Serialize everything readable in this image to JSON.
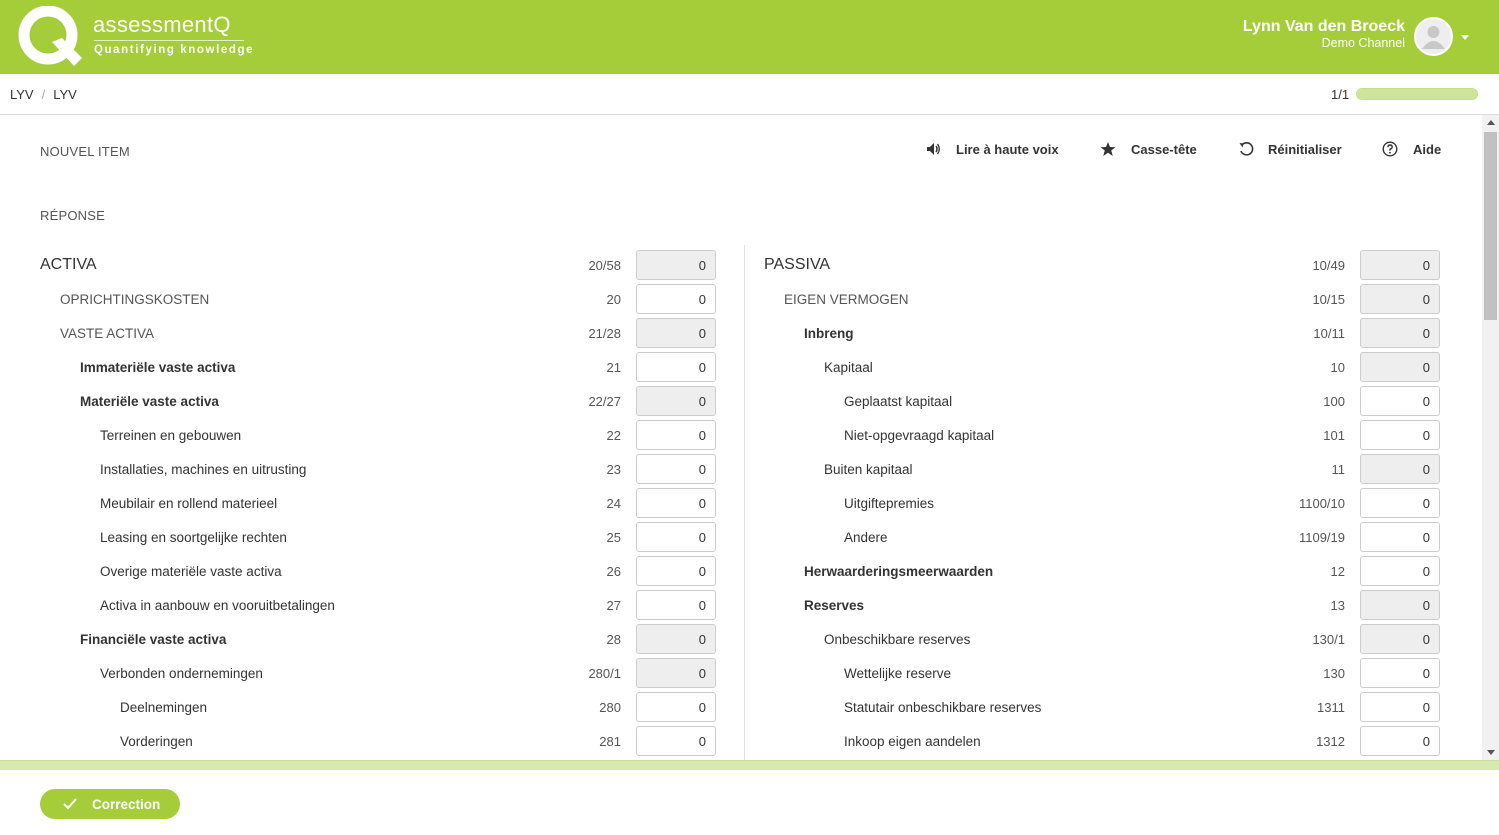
{
  "brand": {
    "name": "assessmentQ",
    "tagline": "Quantifying knowledge",
    "color": "#a5cd39"
  },
  "user": {
    "name": "Lynn Van den Broeck",
    "channel": "Demo Channel"
  },
  "breadcrumb": [
    "LYV",
    "LYV"
  ],
  "progress": {
    "label": "1/1",
    "fraction": 1.0
  },
  "item": {
    "title": "NOUVEL ITEM",
    "response_label": "RÉPONSE"
  },
  "toolbar": {
    "read_aloud": "Lire à haute voix",
    "puzzle": "Casse-tête",
    "reset": "Réinitialiser",
    "help": "Aide"
  },
  "activa": [
    {
      "label": "ACTIVA",
      "code": "20/58",
      "value": "0",
      "level": 0,
      "style": "big",
      "readonly": true
    },
    {
      "label": "OPRICHTINGSKOSTEN",
      "code": "20",
      "value": "0",
      "level": 1,
      "style": "upper",
      "readonly": false
    },
    {
      "label": "VASTE ACTIVA",
      "code": "21/28",
      "value": "0",
      "level": 1,
      "style": "upper",
      "readonly": true
    },
    {
      "label": "Immateriële vaste activa",
      "code": "21",
      "value": "0",
      "level": 2,
      "style": "bold",
      "readonly": false
    },
    {
      "label": "Materiële vaste activa",
      "code": "22/27",
      "value": "0",
      "level": 2,
      "style": "bold",
      "readonly": true
    },
    {
      "label": "Terreinen en gebouwen",
      "code": "22",
      "value": "0",
      "level": 3,
      "style": "normal",
      "readonly": false
    },
    {
      "label": "Installaties, machines en uitrusting",
      "code": "23",
      "value": "0",
      "level": 3,
      "style": "normal",
      "readonly": false
    },
    {
      "label": "Meubilair en rollend materieel",
      "code": "24",
      "value": "0",
      "level": 3,
      "style": "normal",
      "readonly": false
    },
    {
      "label": "Leasing en soortgelijke rechten",
      "code": "25",
      "value": "0",
      "level": 3,
      "style": "normal",
      "readonly": false
    },
    {
      "label": "Overige materiële vaste activa",
      "code": "26",
      "value": "0",
      "level": 3,
      "style": "normal",
      "readonly": false
    },
    {
      "label": "Activa in aanbouw en vooruitbetalingen",
      "code": "27",
      "value": "0",
      "level": 3,
      "style": "normal",
      "readonly": false
    },
    {
      "label": "Financiële vaste activa",
      "code": "28",
      "value": "0",
      "level": 2,
      "style": "bold",
      "readonly": true
    },
    {
      "label": "Verbonden ondernemingen",
      "code": "280/1",
      "value": "0",
      "level": 3,
      "style": "normal",
      "readonly": true
    },
    {
      "label": "Deelnemingen",
      "code": "280",
      "value": "0",
      "level": 4,
      "style": "normal",
      "readonly": false
    },
    {
      "label": "Vorderingen",
      "code": "281",
      "value": "0",
      "level": 4,
      "style": "normal",
      "readonly": false
    }
  ],
  "passiva": [
    {
      "label": "PASSIVA",
      "code": "10/49",
      "value": "0",
      "level": 0,
      "style": "big",
      "readonly": true
    },
    {
      "label": "EIGEN VERMOGEN",
      "code": "10/15",
      "value": "0",
      "level": 1,
      "style": "upper",
      "readonly": true
    },
    {
      "label": "Inbreng",
      "code": "10/11",
      "value": "0",
      "level": 2,
      "style": "bold",
      "readonly": true
    },
    {
      "label": "Kapitaal",
      "code": "10",
      "value": "0",
      "level": 3,
      "style": "normal",
      "readonly": true
    },
    {
      "label": "Geplaatst kapitaal",
      "code": "100",
      "value": "0",
      "level": 4,
      "style": "normal",
      "readonly": false
    },
    {
      "label": "Niet-opgevraagd kapitaal",
      "code": "101",
      "value": "0",
      "level": 4,
      "style": "normal",
      "readonly": false
    },
    {
      "label": "Buiten kapitaal",
      "code": "11",
      "value": "0",
      "level": 3,
      "style": "normal",
      "readonly": true
    },
    {
      "label": "Uitgiftepremies",
      "code": "1100/10",
      "value": "0",
      "level": 4,
      "style": "normal",
      "readonly": false
    },
    {
      "label": "Andere",
      "code": "1109/19",
      "value": "0",
      "level": 4,
      "style": "normal",
      "readonly": false
    },
    {
      "label": "Herwaarderingsmeerwaarden",
      "code": "12",
      "value": "0",
      "level": 2,
      "style": "bold",
      "readonly": false
    },
    {
      "label": "Reserves",
      "code": "13",
      "value": "0",
      "level": 2,
      "style": "bold",
      "readonly": true
    },
    {
      "label": "Onbeschikbare reserves",
      "code": "130/1",
      "value": "0",
      "level": 3,
      "style": "normal",
      "readonly": true
    },
    {
      "label": "Wettelijke reserve",
      "code": "130",
      "value": "0",
      "level": 4,
      "style": "normal",
      "readonly": false
    },
    {
      "label": "Statutair onbeschikbare reserves",
      "code": "1311",
      "value": "0",
      "level": 4,
      "style": "normal",
      "readonly": false
    },
    {
      "label": "Inkoop eigen aandelen",
      "code": "1312",
      "value": "0",
      "level": 4,
      "style": "normal",
      "readonly": false
    }
  ],
  "footer": {
    "correction_label": "Correction"
  }
}
